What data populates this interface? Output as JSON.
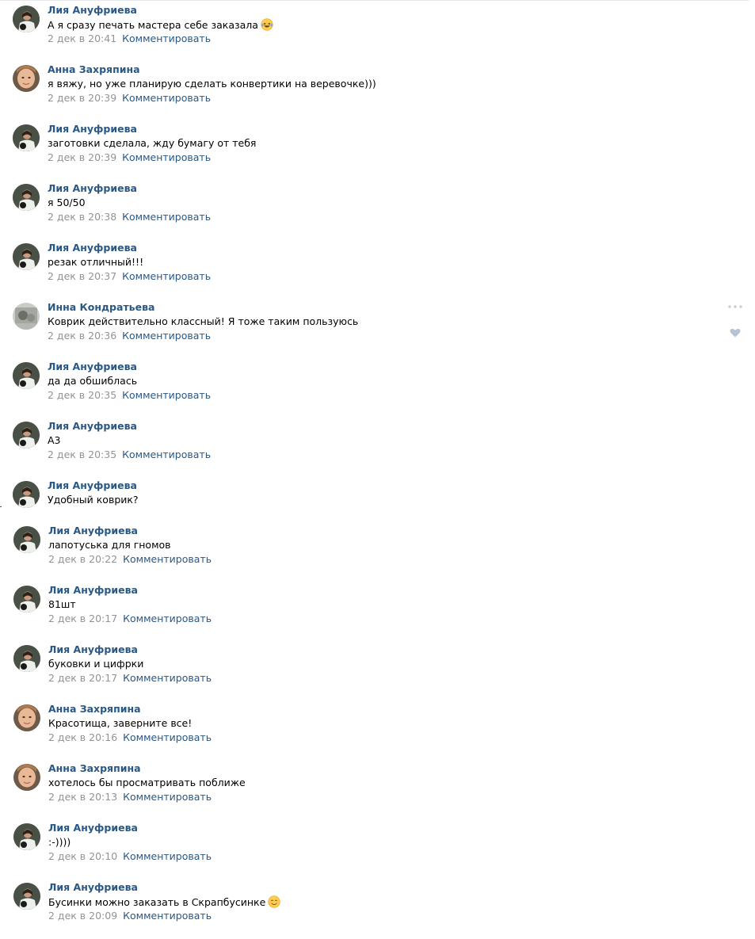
{
  "reply_label": "Комментировать",
  "comments": [
    {
      "author": "Лия Ануфриева",
      "text": "А я сразу печать мастера себе заказала",
      "emoji": "laughing-tears",
      "date": "2 дек в 20:41",
      "avatar": "liya"
    },
    {
      "author": "Анна Захряпина",
      "text": "я вяжу, но уже планирую сделать конвертики на веревочке)))",
      "date": "2 дек в 20:39",
      "avatar": "anna"
    },
    {
      "author": "Лия Ануфриева",
      "text": "заготовки сделала, жду бумагу от тебя",
      "date": "2 дек в 20:39",
      "avatar": "liya"
    },
    {
      "author": "Лия Ануфриева",
      "text": "я 50/50",
      "date": "2 дек в 20:38",
      "avatar": "liya"
    },
    {
      "author": "Лия Ануфриева",
      "text": "резак отличный!!!",
      "date": "2 дек в 20:37",
      "avatar": "liya"
    },
    {
      "author": "Инна Кондратьева",
      "text": "Коврик действительно классный! Я тоже таким пользуюсь",
      "date": "2 дек в 20:36",
      "avatar": "inna",
      "hovered": true
    },
    {
      "author": "Лия Ануфриева",
      "text": "да да обшиблась",
      "date": "2 дек в 20:35",
      "avatar": "liya"
    },
    {
      "author": "Лия Ануфриева",
      "text": "А3",
      "date": "2 дек в 20:35",
      "avatar": "liya"
    },
    {
      "author": "Лия Ануфриева",
      "text": "Удобный коврик?",
      "date": "",
      "avatar": "liya"
    },
    {
      "author": "Лия Ануфриева",
      "text": "лапотуська для гномов",
      "date": "2 дек в 20:22",
      "avatar": "liya"
    },
    {
      "author": "Лия Ануфриева",
      "text": "81шт",
      "date": "2 дек в 20:17",
      "avatar": "liya"
    },
    {
      "author": "Лия Ануфриева",
      "text": "буковки и цифрки",
      "date": "2 дек в 20:17",
      "avatar": "liya"
    },
    {
      "author": "Анна Захряпина",
      "text": "Красотища, заверните все!",
      "date": "2 дек в 20:16",
      "avatar": "anna"
    },
    {
      "author": "Анна Захряпина",
      "text": "хотелось бы просматривать поближе",
      "date": "2 дек в 20:13",
      "avatar": "anna"
    },
    {
      "author": "Лия Ануфриева",
      "text": ":-))))",
      "date": "2 дек в 20:10",
      "avatar": "liya"
    },
    {
      "author": "Лия Ануфриева",
      "text": "Бусинки можно заказать в Скрапбусинке",
      "emoji": "smiling-face",
      "date": "2 дек в 20:09",
      "avatar": "liya"
    }
  ]
}
